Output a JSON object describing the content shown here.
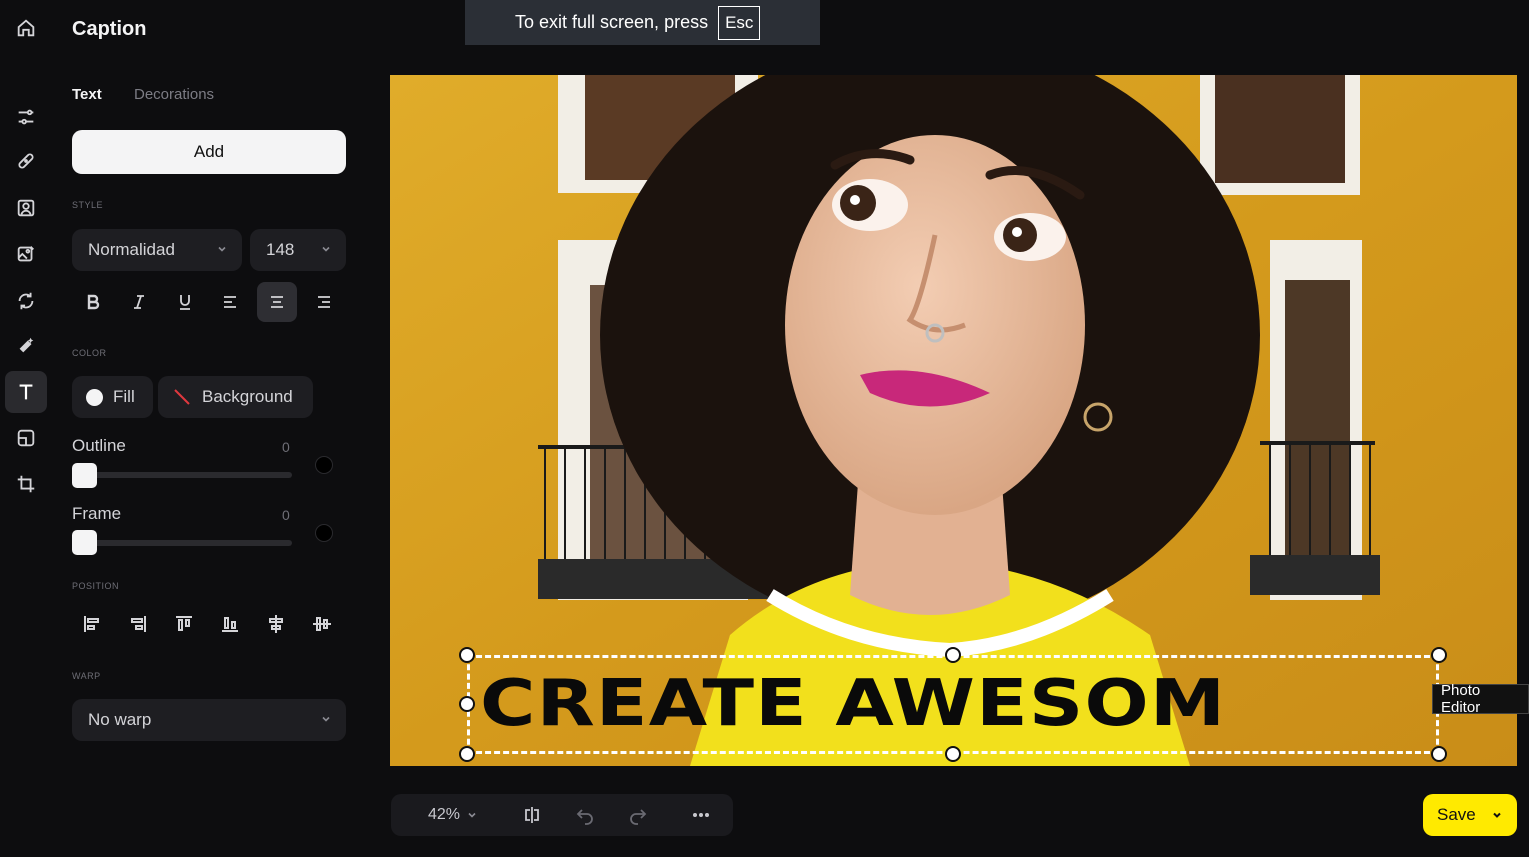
{
  "panel": {
    "title": "Caption",
    "tabs": [
      {
        "label": "Text",
        "active": true
      },
      {
        "label": "Decorations",
        "active": false
      }
    ],
    "add_label": "Add",
    "style": {
      "label": "STYLE",
      "font_value": "Normalidad",
      "size_value": "148",
      "alignment_active": "center"
    },
    "color": {
      "label": "COLOR",
      "fill_label": "Fill",
      "background_label": "Background"
    },
    "outline": {
      "label": "Outline",
      "value": "0"
    },
    "frame": {
      "label": "Frame",
      "value": "0"
    },
    "position": {
      "label": "POSITION"
    },
    "warp": {
      "label": "WARP",
      "value": "No warp"
    }
  },
  "canvas": {
    "caption_text": "CREATE AWESOM",
    "tooltip": "Photo Editor"
  },
  "fullscreen_banner": {
    "message": "To exit full screen, press",
    "key": "Esc"
  },
  "toolbar": {
    "zoom": "42%",
    "save_label": "Save"
  },
  "colors": {
    "accent": "#ffea00",
    "panel_bg": "#0d0d0f",
    "control_bg": "#1e1e22"
  }
}
